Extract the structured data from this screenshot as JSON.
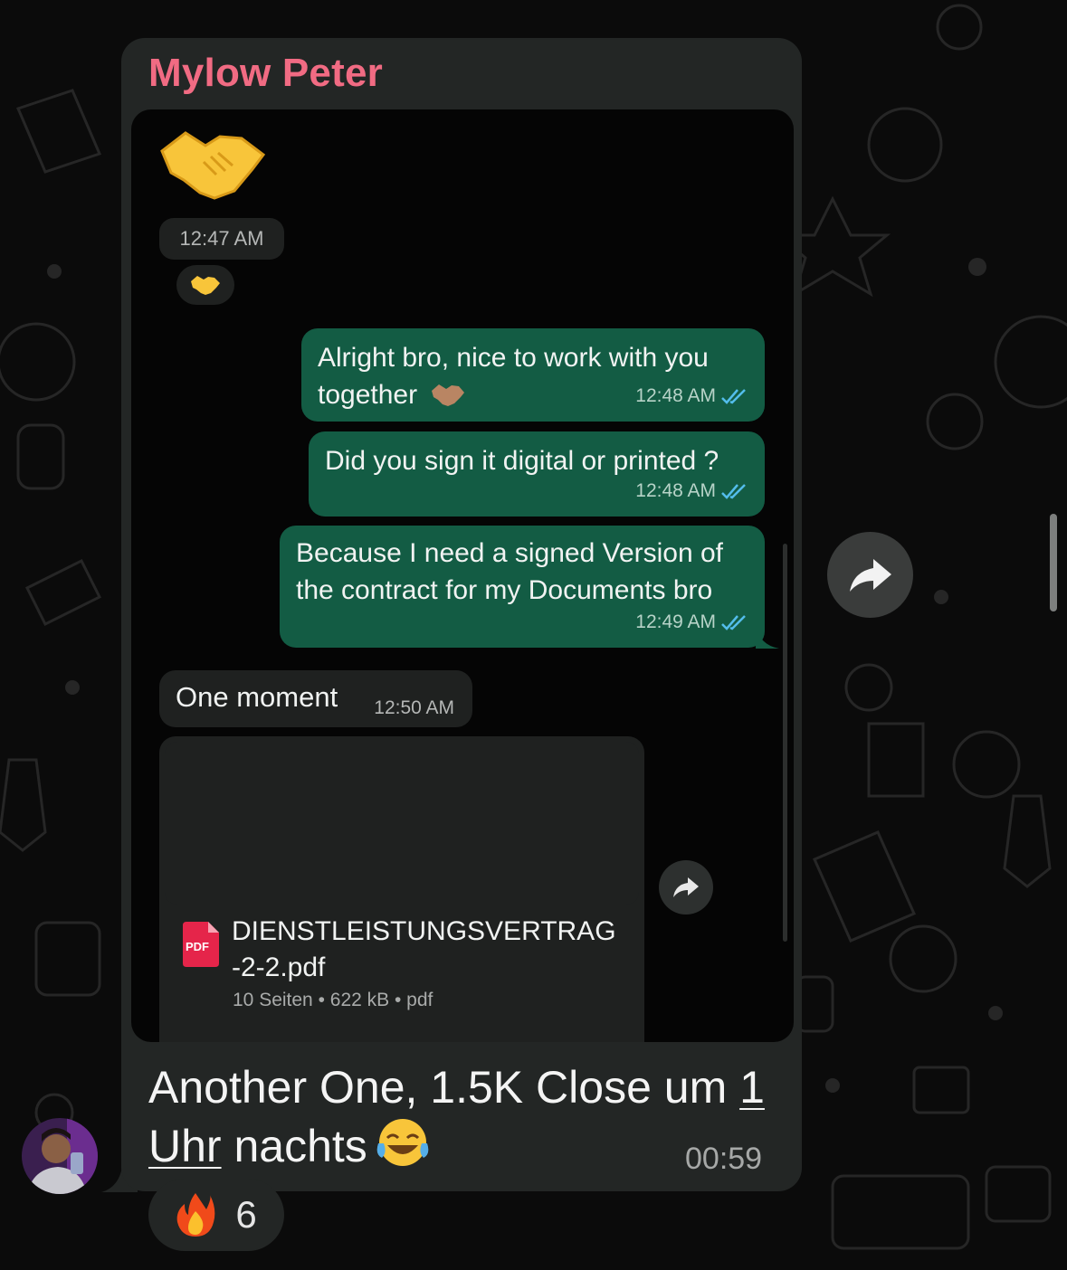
{
  "message": {
    "sender": "Mylow Peter",
    "caption_line1_a": "Another One, 1.5K Close um ",
    "caption_line1_b": "1",
    "caption_line2_a": "Uhr",
    "caption_line2_b": " nachts",
    "time": "00:59",
    "reaction": {
      "emoji": "🔥",
      "count": "6"
    }
  },
  "screenshot": {
    "first_time": "12:47 AM",
    "outgoing": [
      {
        "line1": "Alright bro, nice to work with you",
        "line2": "together",
        "time": "12:48 AM"
      },
      {
        "line1": "Did you sign it digital or printed ?",
        "time": "12:48 AM"
      },
      {
        "line1": "Because I need a signed Version of",
        "line2": "the contract for my Documents bro",
        "time": "12:49 AM"
      }
    ],
    "incoming": {
      "text": "One moment",
      "time": "12:50 AM"
    },
    "document": {
      "icon_label": "PDF",
      "name_line1": "DIENSTLEISTUNGSVERTRAG",
      "name_line2": "-2-2.pdf",
      "meta": "10 Seiten • 622 kB • pdf"
    }
  },
  "colors": {
    "sender": "#f16b83",
    "outgoing_bubble": "#135c44",
    "read_ticks": "#53bdeb",
    "bubble": "#232625"
  },
  "icons": [
    "handshake-emoji",
    "double-check-icon",
    "pdf-icon",
    "forward-icon",
    "laughing-emoji",
    "fire-emoji",
    "avatar"
  ]
}
